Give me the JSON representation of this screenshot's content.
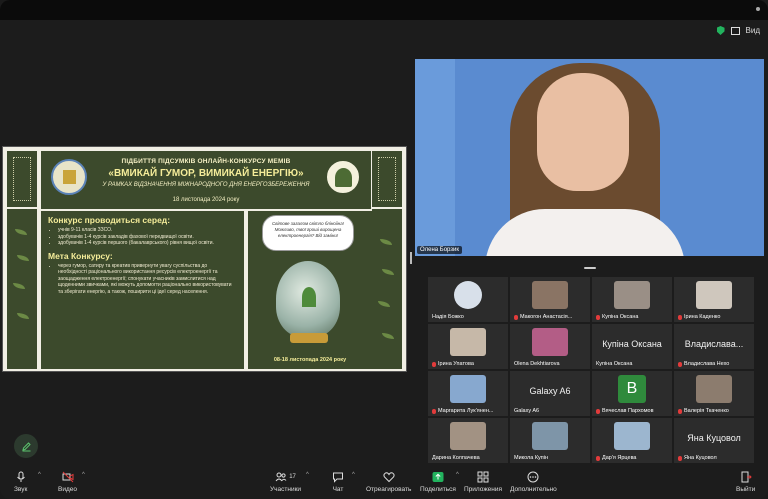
{
  "view": {
    "label": "Вид"
  },
  "slide": {
    "title_small": "ПІДБИТТЯ ПІДСУМКІВ ОНЛАЙН-КОНКУРСУ МЕМІВ",
    "title_big": "«ВМИКАЙ ГУМОР, ВИМИКАЙ ЕНЕРГІЮ»",
    "subtitle": "У РАМКАХ ВІДЗНАЧЕННЯ МІЖНАРОДНОГО ДНЯ ЕНЕРГОЗБЕРЕЖЕННЯ",
    "date": "18 листопада 2024 року",
    "section1_title": "Конкурс проводиться серед:",
    "section1_items": [
      "учнів 9-11 класів ЗЗСО.",
      "здобувачів 1-4 курсів закладів фахової передвищої освіти.",
      "здобувачів 1-4 курсів першого (бакалаврського) рівня вищої освіти."
    ],
    "section2_title": "Мета Конкурсу:",
    "section2_text": "через гумор, сатиру та креатив привернути увагу суспільства до необхідності раціонального використання ресурсів електроенергії та заощадження електроенергії; спонукати учасників замислитися над щоденними звичками, які можуть допомогти раціонально використовувати та зберігати енергію, а також, поширити ці ідеї серед населення.",
    "bubble": "Світове загалом світло бліноііна! Можливо, твої гроші вирощена електроенергія? Від заміни!",
    "poster_date": "08-18 листопада 2024 року"
  },
  "speaker": {
    "name": "Олена Борзик"
  },
  "gallery": [
    {
      "name": "Надія Божко",
      "muted": false,
      "kind": "logo",
      "color": "#d8e0ea"
    },
    {
      "name": "Макогон Анастасія...",
      "muted": true,
      "kind": "photo",
      "color": "#8a7464"
    },
    {
      "name": "Купіна Оксана",
      "muted": true,
      "kind": "photo",
      "color": "#9a8f86"
    },
    {
      "name": "Ірина Каденко",
      "muted": true,
      "kind": "photo",
      "color": "#cfc7bd"
    },
    {
      "name": "Ірина Упатова",
      "muted": true,
      "kind": "photo",
      "color": "#c6b8a8"
    },
    {
      "name": "Olena Dekhtiarova",
      "muted": false,
      "kind": "photo",
      "color": "#b35d86"
    },
    {
      "name": "Купіна Оксана",
      "muted": false,
      "kind": "text",
      "big": "Купіна Оксана"
    },
    {
      "name": "Владислава Нехо",
      "muted": true,
      "kind": "text",
      "big": "Владислава..."
    },
    {
      "name": "Маргарита Лук'янен...",
      "muted": true,
      "kind": "photo",
      "color": "#87a8cf"
    },
    {
      "name": "Galaxy A6",
      "muted": false,
      "kind": "text",
      "big": "Galaxy A6"
    },
    {
      "name": "Вячеслав Пархомов",
      "muted": true,
      "kind": "letter",
      "big": "В",
      "color": "#2f8a3c"
    },
    {
      "name": "Валерія Ткаченко",
      "muted": true,
      "kind": "photo",
      "color": "#8c7c6e"
    },
    {
      "name": "Дарина Колпачева",
      "muted": false,
      "kind": "photo",
      "color": "#a29283"
    },
    {
      "name": "Микола Купін",
      "muted": false,
      "kind": "photo",
      "color": "#7e95a8"
    },
    {
      "name": "Дар'я Ярцева",
      "muted": true,
      "kind": "photo",
      "color": "#9cb6cf"
    },
    {
      "name": "Яна Куцовол",
      "muted": true,
      "kind": "text",
      "big": "Яна Куцовол"
    }
  ],
  "toolbar": {
    "audio": "Звук",
    "video": "Видео",
    "participants": "Участники",
    "participants_count": "17",
    "chat": "Чат",
    "react": "Отреагировать",
    "share": "Поделиться",
    "apps": "Приложения",
    "more": "Дополнительно",
    "leave": "Выйти"
  },
  "colors": {
    "accent_green": "#22b35e",
    "leave_red": "#e23b3b",
    "slide_green": "#3c4a2c"
  }
}
